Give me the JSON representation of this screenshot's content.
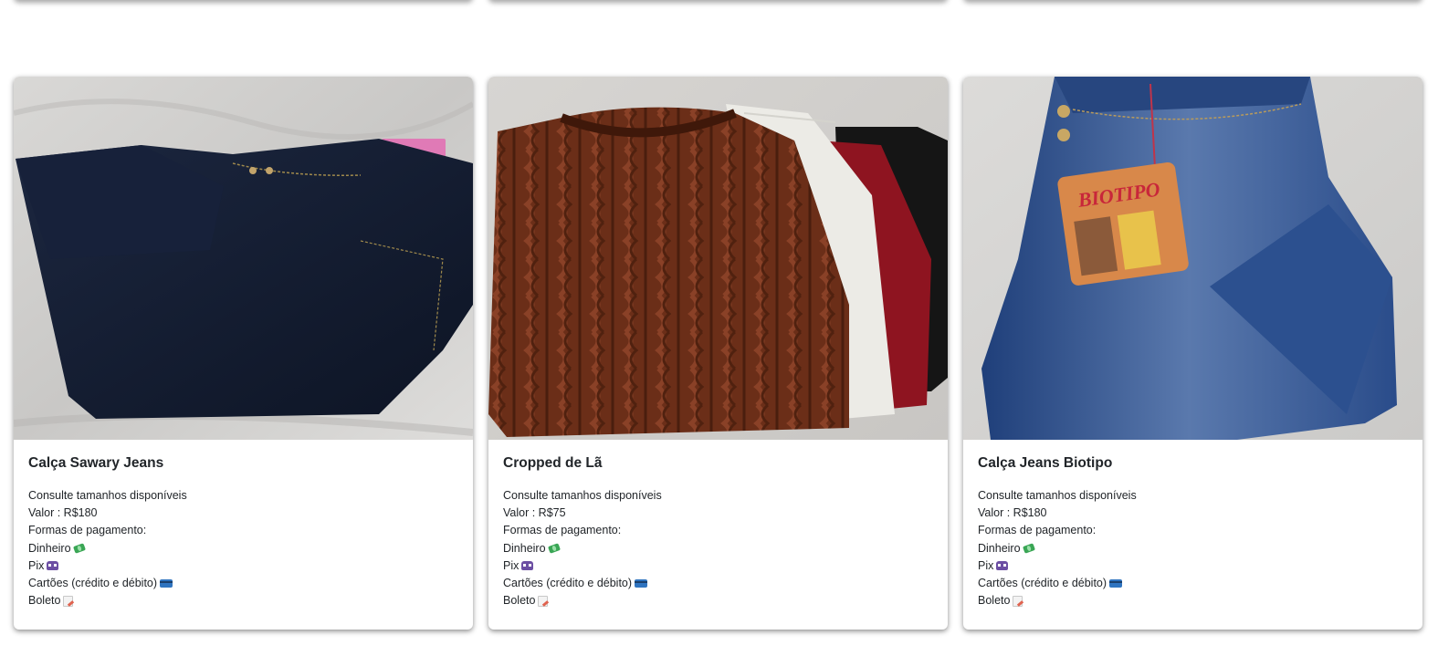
{
  "products": [
    {
      "title": "Calça Sawary Jeans",
      "photo": "dark-jeans-photo",
      "sizes": "Consulte tamanhos disponíveis",
      "price": "Valor : R$180",
      "payment_label": "Formas de pagamento:",
      "payments": [
        {
          "label": "Dinheiro",
          "icon": "money-icon"
        },
        {
          "label": "Pix",
          "icon": "pix-icon"
        },
        {
          "label": "Cartões (crédito e débito)",
          "icon": "credit-card-icon"
        },
        {
          "label": "Boleto",
          "icon": "boleto-icon"
        }
      ]
    },
    {
      "title": "Cropped de Lã",
      "photo": "knit-vests-photo",
      "sizes": "Consulte tamanhos disponíveis",
      "price": "Valor : R$75",
      "payment_label": "Formas de pagamento:",
      "payments": [
        {
          "label": "Dinheiro",
          "icon": "money-icon"
        },
        {
          "label": "Pix",
          "icon": "pix-icon"
        },
        {
          "label": "Cartões (crédito e débito)",
          "icon": "credit-card-icon"
        },
        {
          "label": "Boleto",
          "icon": "boleto-icon"
        }
      ]
    },
    {
      "title": "Calça Jeans Biotipo",
      "photo": "blue-jeans-photo",
      "tag_text": "BIOTIPO",
      "sizes": "Consulte tamanhos disponíveis",
      "price": "Valor : R$180",
      "payment_label": "Formas de pagamento:",
      "payments": [
        {
          "label": "Dinheiro",
          "icon": "money-icon"
        },
        {
          "label": "Pix",
          "icon": "pix-icon"
        },
        {
          "label": "Cartões (crédito e débito)",
          "icon": "credit-card-icon"
        },
        {
          "label": "Boleto",
          "icon": "boleto-icon"
        }
      ]
    }
  ]
}
